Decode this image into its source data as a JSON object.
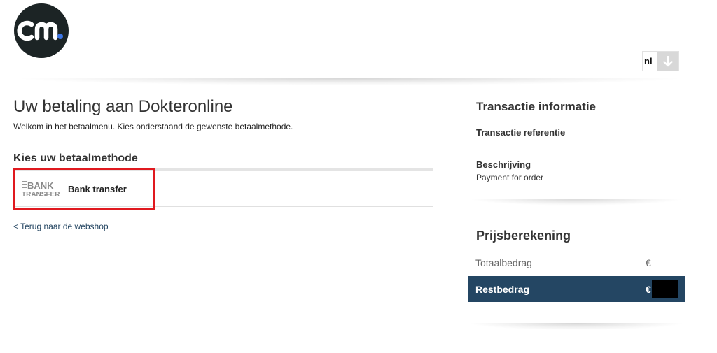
{
  "brand": {
    "logo_name": "cm-logo",
    "colors": {
      "dark": "#1c2425",
      "dot": "#3d75e4"
    }
  },
  "language": {
    "selected": "nl"
  },
  "main": {
    "title": "Uw betaling aan Dokteronline",
    "intro": "Welkom in het betaalmenu. Kies onderstaand de gewenste betaalmethode.",
    "method_section_title": "Kies uw betaalmethode",
    "methods": [
      {
        "label": "Bank transfer",
        "logo_lines": [
          "BANK",
          "TRANSFER"
        ],
        "highlighted": true
      }
    ],
    "back_link": "< Terug naar de webshop"
  },
  "transaction": {
    "title": "Transactie informatie",
    "reference_label": "Transactie referentie",
    "description_label": "Beschrijving",
    "description_value": "Payment for order"
  },
  "pricing": {
    "title": "Prijsberekening",
    "total_label": "Totaalbedrag",
    "total_value": "€",
    "rest_label": "Restbedrag",
    "rest_value": "€",
    "colors": {
      "rest_background": "#244663",
      "highlight_border": "#e0191f"
    }
  }
}
